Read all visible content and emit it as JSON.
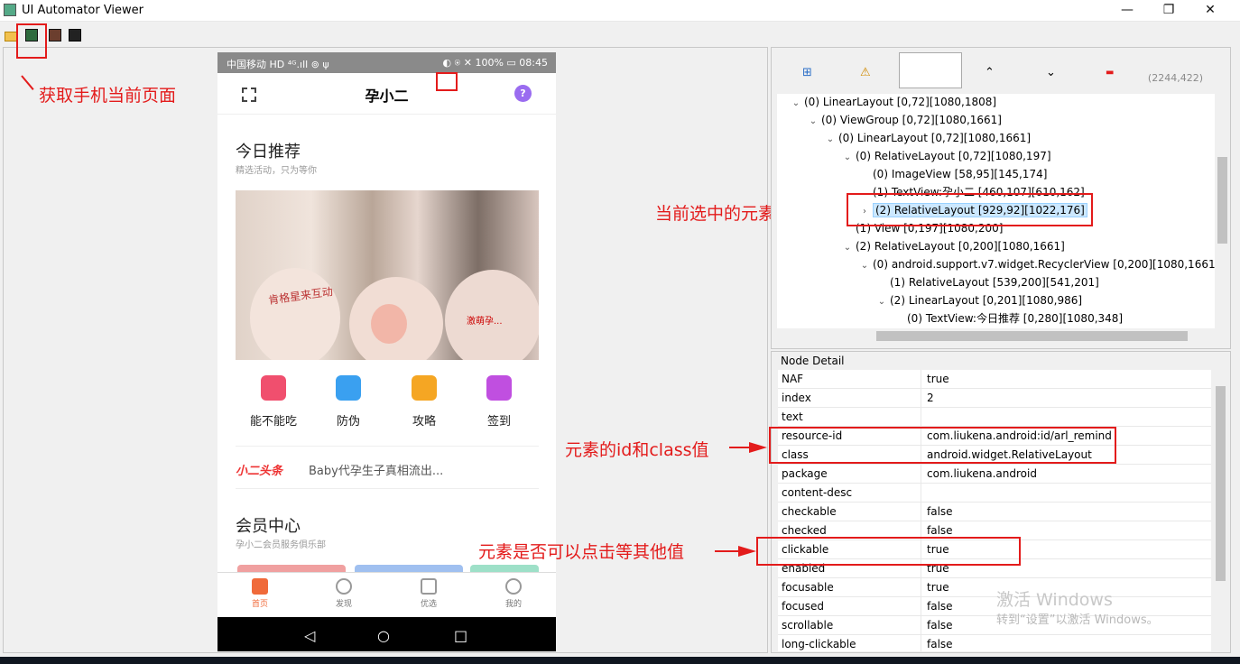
{
  "window": {
    "title": "UI Automator Viewer",
    "minimize": "—",
    "restore": "❐",
    "close": "✕"
  },
  "phone": {
    "status_left": "中国移动 HD ⁴ᴳ.ıll ⊚ ψ",
    "status_right": "◐ ⍟ ✕ 100% ▭ 08:45",
    "app_title": "孕小二",
    "help": "?",
    "section1_title": "今日推荐",
    "section1_sub": "精选活动，只为等你",
    "banner_text1": "肯格星来互动",
    "banner_text2": "激萌孕...",
    "quick": [
      {
        "label": "能不能吃",
        "color": "#f04f6e"
      },
      {
        "label": "防伪",
        "color": "#3aa0f0"
      },
      {
        "label": "攻略",
        "color": "#f5a623"
      },
      {
        "label": "签到",
        "color": "#c04fe0"
      }
    ],
    "news_logo": "小二头条",
    "news_text": "Baby代孕生子真相流出...",
    "section2_title": "会员中心",
    "section2_sub": "孕小二会员服务俱乐部",
    "nav": [
      {
        "label": "首页",
        "color": "#f06a3a"
      },
      {
        "label": "发现",
        "color": "#777777"
      },
      {
        "label": "优选",
        "color": "#777777"
      },
      {
        "label": "我的",
        "color": "#777777"
      }
    ],
    "sys_back": "◁",
    "sys_home": "○",
    "sys_recent": "□"
  },
  "annotations": {
    "capture": "获取手机当前页面",
    "selected": "当前选中的元素",
    "idclass": "元素的id和class值",
    "clickable": "元素是否可以点击等其他值"
  },
  "tree_toolbar": {
    "coords": "(2244,422)",
    "expand_icon": "⊞",
    "warning_icon": "⚠",
    "up": "⌃",
    "down": "⌄",
    "minus": "▬"
  },
  "tree": [
    {
      "arrow": "⌄",
      "text": "(0) LinearLayout [0,72][1080,1808]"
    },
    {
      "arrow": "⌄",
      "text": "(0) ViewGroup [0,72][1080,1661]"
    },
    {
      "arrow": "⌄",
      "text": "(0) LinearLayout [0,72][1080,1661]"
    },
    {
      "arrow": "⌄",
      "text": "(0) RelativeLayout [0,72][1080,197]"
    },
    {
      "arrow": "",
      "text": "(0) ImageView [58,95][145,174]"
    },
    {
      "arrow": "",
      "text": "(1) TextView:孕小二 [460,107][610,162]"
    },
    {
      "arrow": "›",
      "text": "(2) RelativeLayout [929,92][1022,176]"
    },
    {
      "arrow": "",
      "text": "(1) View [0,197][1080,200]"
    },
    {
      "arrow": "⌄",
      "text": "(2) RelativeLayout [0,200][1080,1661]"
    },
    {
      "arrow": "⌄",
      "text": "(0) android.support.v7.widget.RecyclerView [0,200][1080,1661]"
    },
    {
      "arrow": "",
      "text": "(1) RelativeLayout [539,200][541,201]"
    },
    {
      "arrow": "⌄",
      "text": "(2) LinearLayout [0,201][1080,986]"
    },
    {
      "arrow": "",
      "text": "(0) TextView:今日推荐 [0,280][1080,348]"
    }
  ],
  "node_detail": {
    "legend": "Node Detail",
    "rows": [
      {
        "k": "NAF",
        "v": "true"
      },
      {
        "k": "index",
        "v": "2"
      },
      {
        "k": "text",
        "v": ""
      },
      {
        "k": "resource-id",
        "v": "com.liukena.android:id/arl_remind"
      },
      {
        "k": "class",
        "v": "android.widget.RelativeLayout"
      },
      {
        "k": "package",
        "v": "com.liukena.android"
      },
      {
        "k": "content-desc",
        "v": ""
      },
      {
        "k": "checkable",
        "v": "false"
      },
      {
        "k": "checked",
        "v": "false"
      },
      {
        "k": "clickable",
        "v": "true"
      },
      {
        "k": "enabled",
        "v": "true"
      },
      {
        "k": "focusable",
        "v": "true"
      },
      {
        "k": "focused",
        "v": "false"
      },
      {
        "k": "scrollable",
        "v": "false"
      },
      {
        "k": "long-clickable",
        "v": "false"
      }
    ]
  },
  "watermark": {
    "line1": "激活 Windows",
    "line2": "转到“设置”以激活 Windows。"
  }
}
